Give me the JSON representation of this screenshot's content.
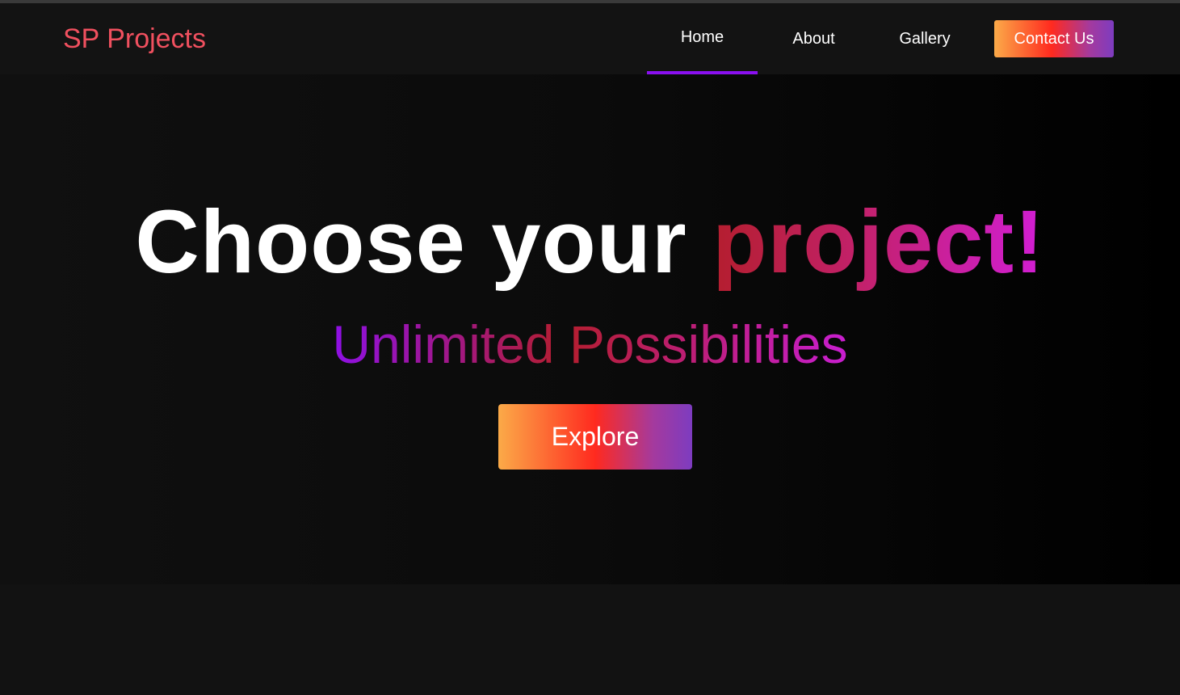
{
  "brand": {
    "name": "SP Projects"
  },
  "nav": {
    "items": [
      {
        "label": "Home",
        "active": true
      },
      {
        "label": "About",
        "active": false
      },
      {
        "label": "Gallery",
        "active": false
      }
    ],
    "contact_label": "Contact Us"
  },
  "hero": {
    "headline_plain": "Choose your ",
    "headline_highlight": "project!",
    "subheadline": "Unlimited Possibilities",
    "cta_label": "Explore"
  },
  "colors": {
    "background": "#121212",
    "brand": "#f0505f",
    "active_underline": "#8a10f0",
    "gradient_start": "#fbaa48",
    "gradient_mid": "#ff2a1f",
    "gradient_end": "#7d3cc0"
  }
}
